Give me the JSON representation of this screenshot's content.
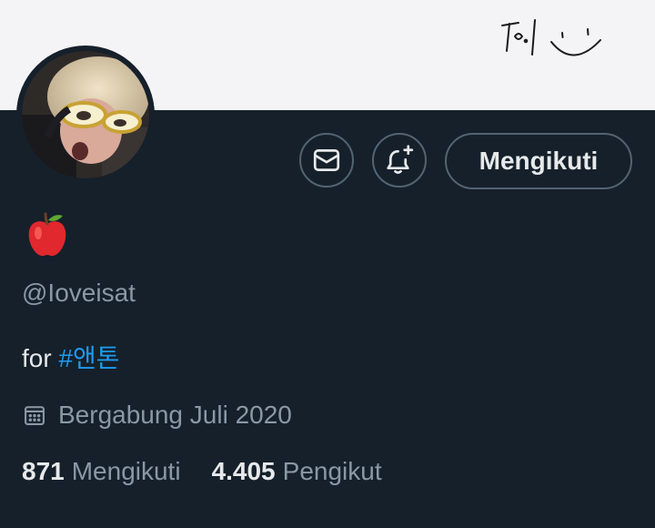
{
  "profile": {
    "handle": "@Ioveisat",
    "bio_prefix": "for ",
    "bio_hashtag": "#앤톤",
    "joined": "Bergabung Juli 2020",
    "display_name_icon": "red-apple-emoji"
  },
  "actions": {
    "message_icon": "envelope-icon",
    "notify_icon": "bell-plus-icon",
    "follow_label": "Mengikuti"
  },
  "stats": {
    "following_count": "871",
    "following_label": "Mengikuti",
    "followers_count": "4.405",
    "followers_label": "Pengikut"
  },
  "colors": {
    "background": "#15202b",
    "banner": "#f4f4f6",
    "text_primary": "#e7e9ea",
    "text_secondary": "#8b98a5",
    "accent": "#1d9bf0",
    "border": "#536471"
  }
}
